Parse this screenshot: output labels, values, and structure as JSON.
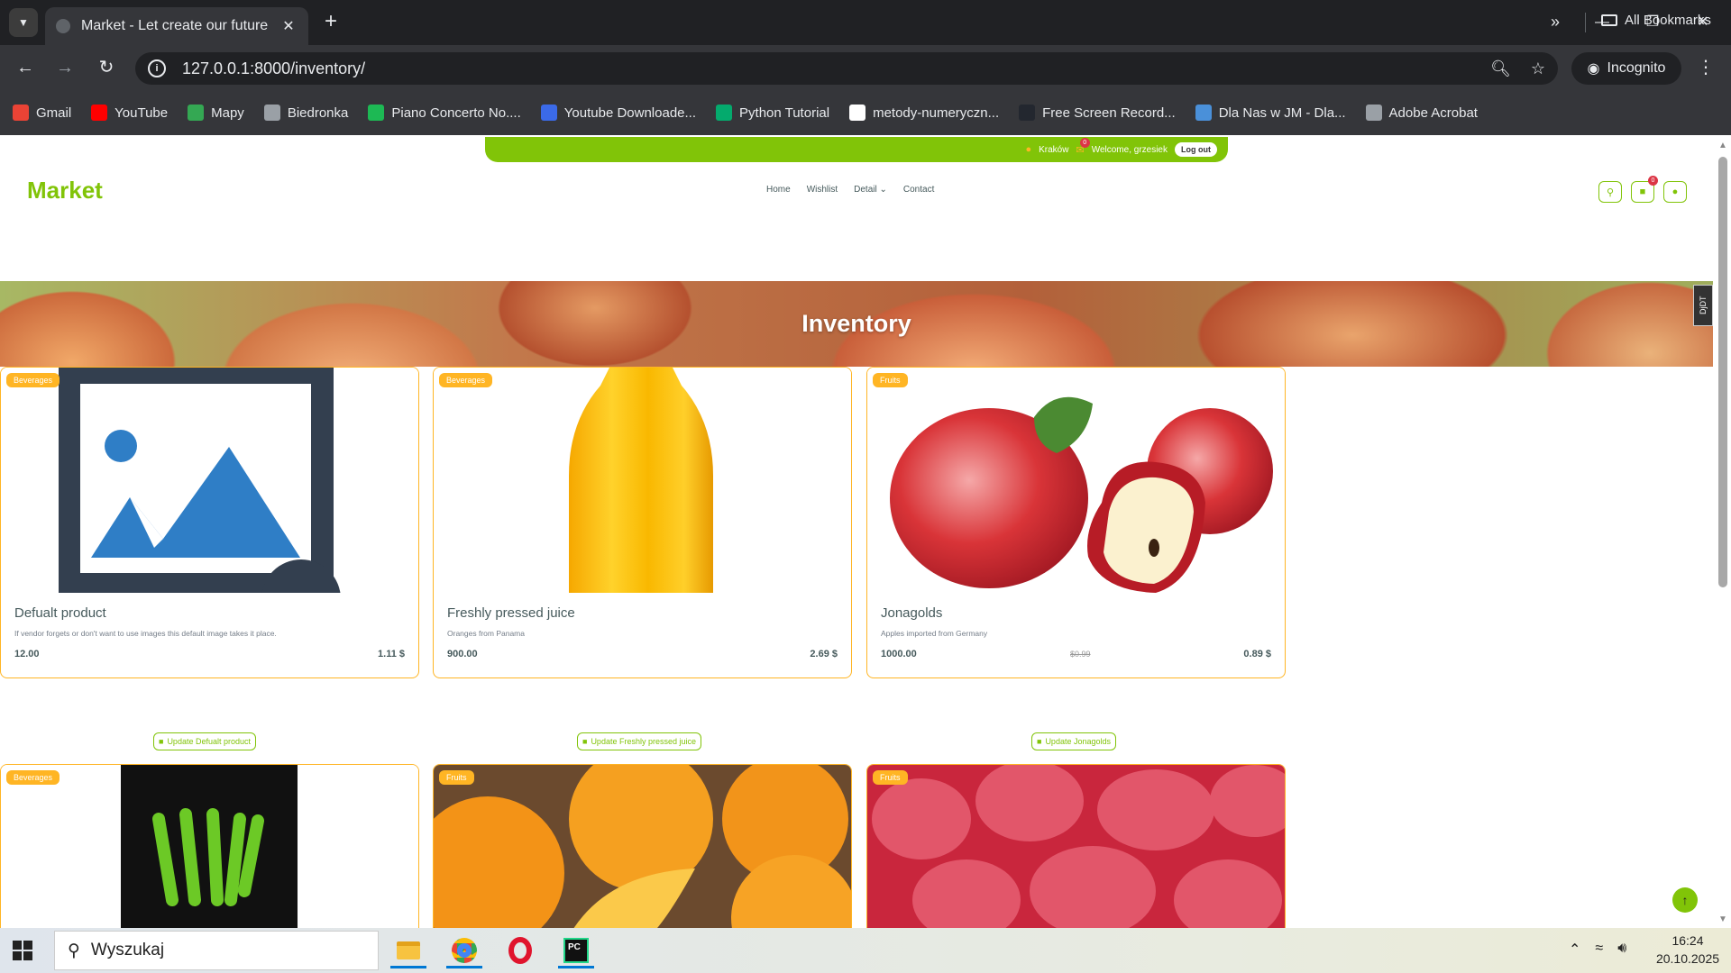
{
  "browser": {
    "tab_title": "Market - Let create our future",
    "url": "127.0.0.1:8000/inventory/",
    "incognito_label": "Incognito",
    "bookmarks": [
      {
        "label": "Gmail",
        "icon": "gmail-icon",
        "color": "#ea4335"
      },
      {
        "label": "YouTube",
        "icon": "youtube-icon",
        "color": "#ff0000"
      },
      {
        "label": "Mapy",
        "icon": "maps-icon",
        "color": "#34a853"
      },
      {
        "label": "Biedronka",
        "icon": "folder-icon",
        "color": "#9aa0a6"
      },
      {
        "label": "Piano Concerto No....",
        "icon": "spotify-icon",
        "color": "#1db954"
      },
      {
        "label": "Youtube Downloade...",
        "icon": "download-icon",
        "color": "#3b6ae8"
      },
      {
        "label": "Python Tutorial",
        "icon": "w3schools-icon",
        "color": "#04aa6d"
      },
      {
        "label": "metody-numeryczn...",
        "icon": "github-icon",
        "color": "#ffffff"
      },
      {
        "label": "Free Screen Record...",
        "icon": "recorder-icon",
        "color": "#23272f"
      },
      {
        "label": "Dla Nas w JM - Dla...",
        "icon": "dlanas-icon",
        "color": "#4a90d9"
      },
      {
        "label": "Adobe Acrobat",
        "icon": "globe-icon",
        "color": "#9aa0a6"
      }
    ],
    "all_bookmarks_label": "All Bookmarks"
  },
  "site": {
    "topbar": {
      "location": "Kraków",
      "mail_count": "0",
      "welcome": "Welcome, grzesiek",
      "logout_label": "Log out"
    },
    "brand": "Market",
    "nav": [
      {
        "label": "Home"
      },
      {
        "label": "Wishlist"
      },
      {
        "label": "Detail"
      },
      {
        "label": "Contact"
      }
    ],
    "cart_count": "0",
    "hero_title": "Inventory",
    "side_tag": "DjDT",
    "accent_color": "#81c408",
    "badge_color": "#ffb524"
  },
  "products": [
    {
      "category": "Beverages",
      "title": "Defualt product",
      "description": "If vendor forgets or don't want to use images this default image takes it place.",
      "quantity": "12.00",
      "old_price": "",
      "price": "1.11 $",
      "update_label": "Update Defualt product"
    },
    {
      "category": "Beverages",
      "title": "Freshly pressed juice",
      "description": "Oranges from Panama",
      "quantity": "900.00",
      "old_price": "",
      "price": "2.69 $",
      "update_label": "Update Freshly pressed juice"
    },
    {
      "category": "Fruits",
      "title": "Jonagolds",
      "description": "Apples imported from Germany",
      "quantity": "1000.00",
      "old_price": "$0.99",
      "price": "0.89 $",
      "update_label": "Update Jonagolds"
    }
  ],
  "products_row2": [
    {
      "category": "Beverages"
    },
    {
      "category": "Fruits"
    },
    {
      "category": "Fruits"
    }
  ],
  "taskbar": {
    "search_placeholder": "Wyszukaj",
    "time": "16:24",
    "date": "20.10.2025"
  }
}
